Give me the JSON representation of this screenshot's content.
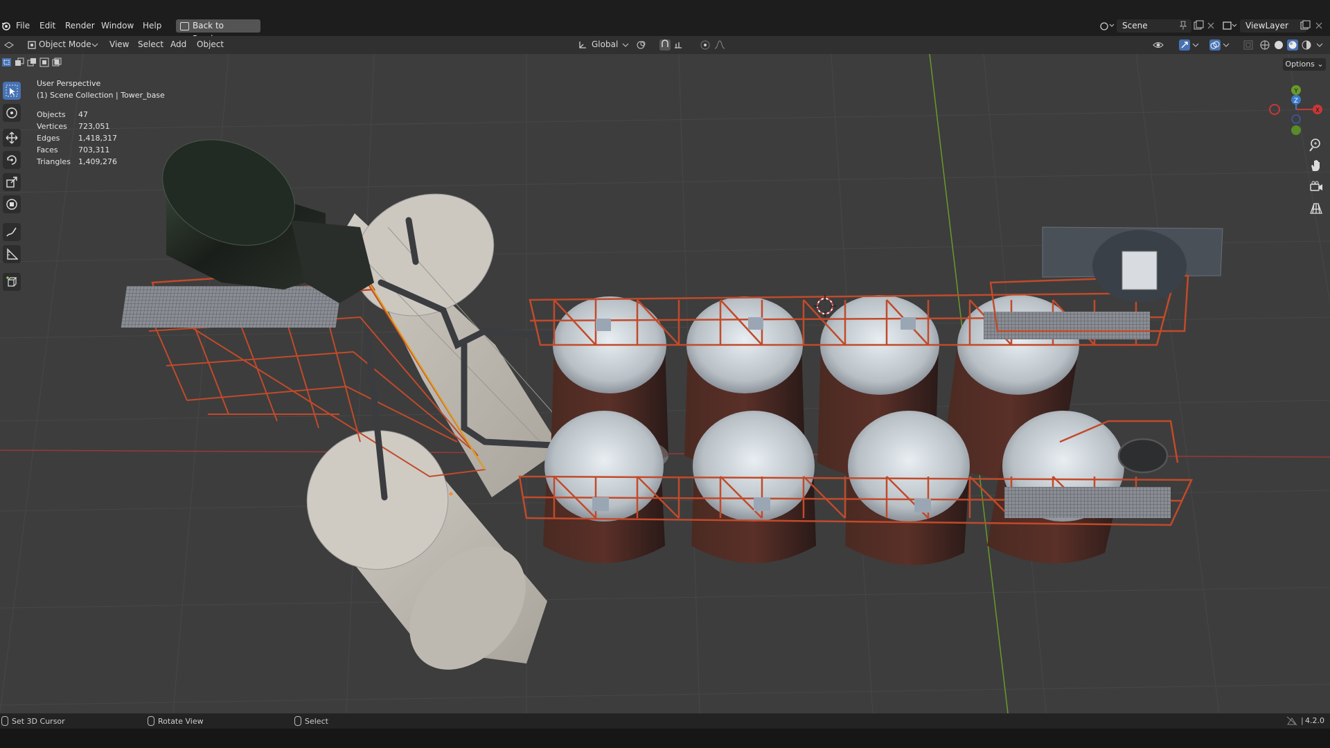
{
  "menubar": {
    "items": [
      "File",
      "Edit",
      "Render",
      "Window",
      "Help"
    ],
    "back_button": "Back to Previous",
    "scene": "Scene",
    "view_layer": "ViewLayer"
  },
  "header": {
    "mode": "Object Mode",
    "menus": [
      "View",
      "Select",
      "Add",
      "Object"
    ],
    "orientation": "Global",
    "options": "Options"
  },
  "viewport": {
    "perspective": "User Perspective",
    "collection": "(1) Scene Collection | Tower_base",
    "stats": [
      {
        "label": "Objects",
        "value": "47"
      },
      {
        "label": "Vertices",
        "value": "723,051"
      },
      {
        "label": "Edges",
        "value": "1,418,317"
      },
      {
        "label": "Faces",
        "value": "703,311"
      },
      {
        "label": "Triangles",
        "value": "1,409,276"
      }
    ],
    "gizmo_axes": {
      "x": "X",
      "y": "Y",
      "z": "Z"
    }
  },
  "statusbar": {
    "items": [
      "Set 3D Cursor",
      "Rotate View",
      "Select"
    ],
    "version": "4.2.0"
  },
  "colors": {
    "accent": "#4772b3",
    "grid_x_axis": "#a33a3a",
    "grid_y_axis": "#6a9a2a",
    "frame_orange": "#c24a2a"
  }
}
